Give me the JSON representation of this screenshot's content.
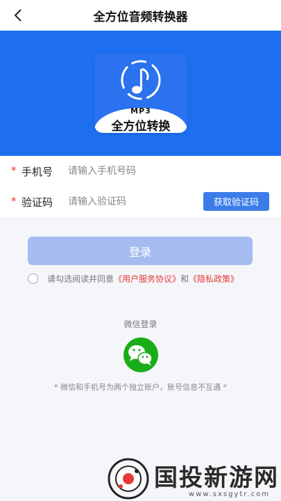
{
  "header": {
    "title": "全方位音频转换器",
    "back_icon": "chevron-left-icon"
  },
  "banner": {
    "color": "#1e6ff0",
    "app_icon": {
      "badge": "MP3",
      "name": "全方位转换",
      "icon": "music-note-icon"
    }
  },
  "form": {
    "required_mark": "*",
    "phone": {
      "label": "手机号",
      "placeholder": "请输入手机号码",
      "value": ""
    },
    "code": {
      "label": "验证码",
      "placeholder": "请输入验证码",
      "value": "",
      "button": "获取验证码"
    }
  },
  "login_button": "登录",
  "agreement": {
    "checked": false,
    "prefix": "请勾选阅读并同意",
    "terms": "《用户服务协议》",
    "and": "和",
    "privacy": "《隐私政策》"
  },
  "wechat": {
    "label": "微信登录",
    "icon": "wechat-icon",
    "color": "#1aad19"
  },
  "note": "* 微信和手机号为两个独立账户，账号信息不互通 *",
  "watermark": {
    "name": "国投新游网",
    "url": "www.sxsgytr.com"
  },
  "colors": {
    "accent": "#3b7ce8",
    "login_disabled": "#a6bcf0",
    "required": "#e53935"
  }
}
